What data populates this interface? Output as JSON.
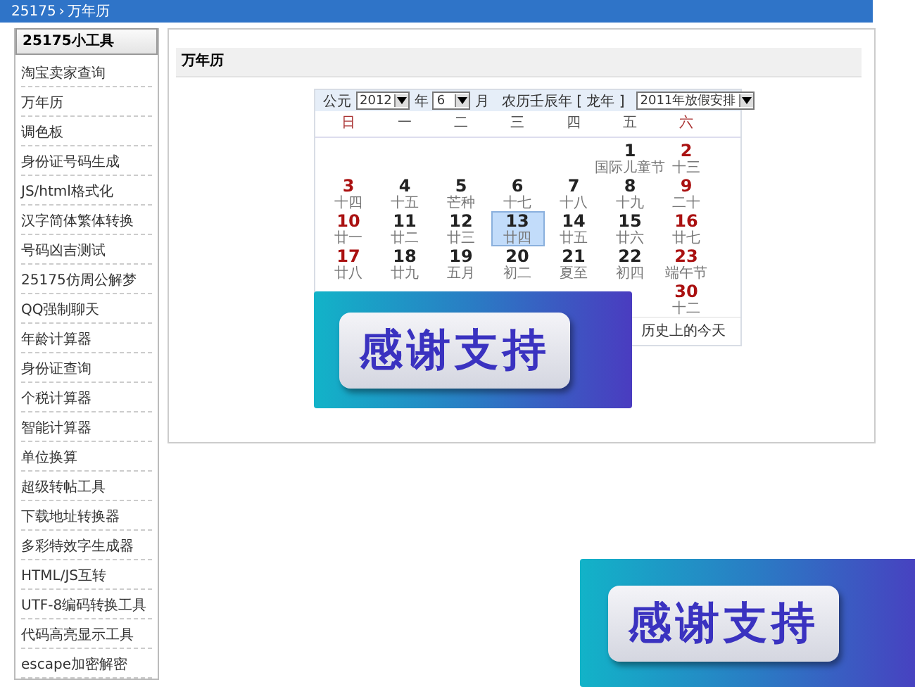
{
  "breadcrumb": {
    "site": "25175",
    "separator": "›",
    "page": "万年历"
  },
  "sidebar": {
    "title": "25175小工具",
    "items": [
      "淘宝卖家查询",
      "万年历",
      "调色板",
      "身份证号码生成",
      "JS/html格式化",
      "汉字简体繁体转换",
      "号码凶吉测试",
      "25175仿周公解梦",
      "QQ强制聊天",
      "年龄计算器",
      "身份证查询",
      "个税计算器",
      "智能计算器",
      "单位换算",
      "超级转帖工具",
      "下载地址转换器",
      "多彩特效字生成器",
      "HTML/JS互转",
      "UTF-8编码转换工具",
      "代码高亮显示工具",
      "escape加密解密"
    ]
  },
  "panel": {
    "title": "万年历"
  },
  "calendar": {
    "era_label": "公元",
    "year": "2012",
    "year_label": "年",
    "month": "6",
    "month_label": "月",
    "lunar_year": "农历壬辰年 [ 龙年 ]",
    "holiday_select": "2011年放假安排",
    "weekdays": [
      "日",
      "一",
      "二",
      "三",
      "四",
      "五",
      "六"
    ],
    "weeks": [
      [
        {
          "day": "1",
          "lunar": "国际儿童节",
          "selected": false
        },
        {
          "day": "2",
          "lunar": "十三",
          "selected": false
        }
      ],
      [
        {
          "day": "3",
          "lunar": "十四",
          "selected": false
        },
        {
          "day": "4",
          "lunar": "十五",
          "selected": false
        },
        {
          "day": "5",
          "lunar": "芒种",
          "selected": false
        },
        {
          "day": "6",
          "lunar": "十七",
          "selected": false
        },
        {
          "day": "7",
          "lunar": "十八",
          "selected": false
        },
        {
          "day": "8",
          "lunar": "十九",
          "selected": false
        },
        {
          "day": "9",
          "lunar": "二十",
          "selected": false
        }
      ],
      [
        {
          "day": "10",
          "lunar": "廿一",
          "selected": false
        },
        {
          "day": "11",
          "lunar": "廿二",
          "selected": false
        },
        {
          "day": "12",
          "lunar": "廿三",
          "selected": false
        },
        {
          "day": "13",
          "lunar": "廿四",
          "selected": true
        },
        {
          "day": "14",
          "lunar": "廿五",
          "selected": false
        },
        {
          "day": "15",
          "lunar": "廿六",
          "selected": false
        },
        {
          "day": "16",
          "lunar": "廿七",
          "selected": false
        }
      ],
      [
        {
          "day": "17",
          "lunar": "廿八",
          "selected": false
        },
        {
          "day": "18",
          "lunar": "廿九",
          "selected": false
        },
        {
          "day": "19",
          "lunar": "五月",
          "selected": false
        },
        {
          "day": "20",
          "lunar": "初二",
          "selected": false
        },
        {
          "day": "21",
          "lunar": "夏至",
          "selected": false
        },
        {
          "day": "22",
          "lunar": "初四",
          "selected": false
        },
        {
          "day": "23",
          "lunar": "端午节",
          "selected": false
        }
      ],
      [
        {
          "day": "30",
          "lunar": "十二",
          "selected": false
        }
      ]
    ],
    "history_link": "历史上的今天"
  },
  "banners": [
    "感谢支持",
    "感谢支持"
  ]
}
